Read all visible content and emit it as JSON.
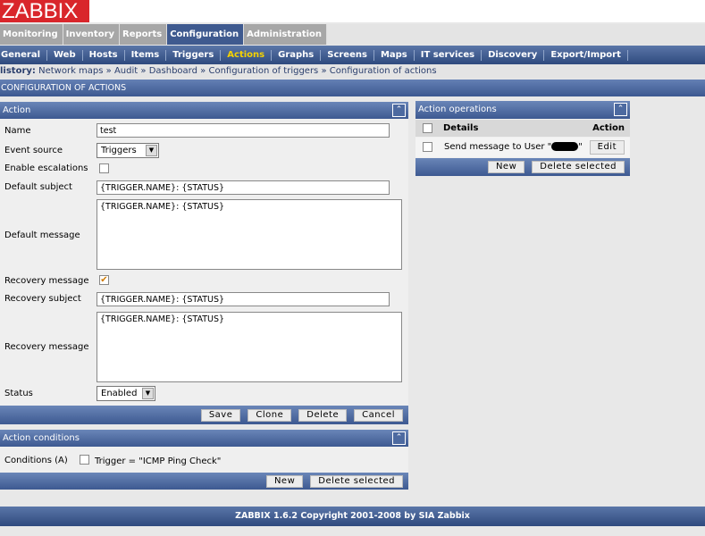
{
  "logo": "ZABBIX",
  "main_menu": [
    {
      "label": "Monitoring"
    },
    {
      "label": "Inventory"
    },
    {
      "label": "Reports"
    },
    {
      "label": "Configuration",
      "active": true
    },
    {
      "label": "Administration"
    }
  ],
  "sub_menu": [
    {
      "label": "General"
    },
    {
      "label": "Web"
    },
    {
      "label": "Hosts"
    },
    {
      "label": "Items"
    },
    {
      "label": "Triggers"
    },
    {
      "label": "Actions",
      "active": true
    },
    {
      "label": "Graphs"
    },
    {
      "label": "Screens"
    },
    {
      "label": "Maps"
    },
    {
      "label": "IT services"
    },
    {
      "label": "Discovery"
    },
    {
      "label": "Export/Import"
    }
  ],
  "history": {
    "label": "listory:",
    "items": [
      "Network maps",
      "Audit",
      "Dashboard",
      "Configuration of triggers",
      "Configuration of actions"
    ],
    "sep": "»"
  },
  "page_title": "CONFIGURATION OF ACTIONS",
  "action": {
    "title": "Action",
    "name_label": "Name",
    "name_value": "test",
    "event_source_label": "Event source",
    "event_source_value": "Triggers",
    "escalations_label": "Enable escalations",
    "default_subject_label": "Default subject",
    "default_subject_value": "{TRIGGER.NAME}: {STATUS}",
    "default_message_label": "Default message",
    "default_message_value": "{TRIGGER.NAME}: {STATUS}",
    "recovery_message_cb_label": "Recovery message",
    "recovery_checked_mark": "✔",
    "recovery_subject_label": "Recovery subject",
    "recovery_subject_value": "{TRIGGER.NAME}: {STATUS}",
    "recovery_message_label": "Recovery message",
    "recovery_message_value": "{TRIGGER.NAME}: {STATUS}",
    "status_label": "Status",
    "status_value": "Enabled",
    "buttons": {
      "save": "Save",
      "clone": "Clone",
      "delete": "Delete",
      "cancel": "Cancel"
    }
  },
  "conditions": {
    "title": "Action conditions",
    "label": "Conditions (A)",
    "item": "Trigger = \"ICMP Ping Check\"",
    "buttons": {
      "new": "New",
      "delete_selected": "Delete selected"
    }
  },
  "operations": {
    "title": "Action operations",
    "col_details": "Details",
    "col_action": "Action",
    "row_text": "Send message to User \"",
    "row_end": "\"",
    "edit": "Edit",
    "buttons": {
      "new": "New",
      "delete_selected": "Delete selected"
    }
  },
  "footer": "ZABBIX 1.6.2 Copyright 2001-2008 by  SIA Zabbix"
}
